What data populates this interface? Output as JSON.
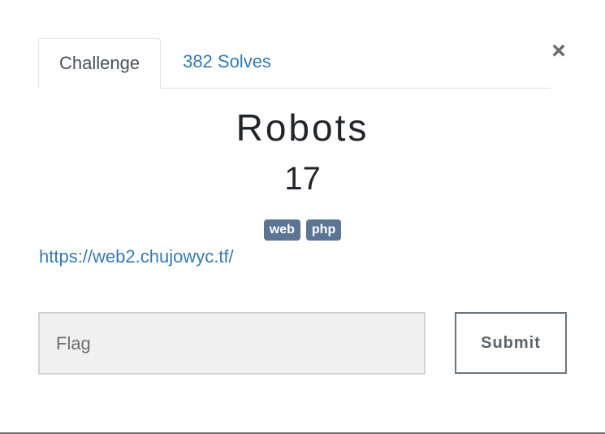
{
  "tabs": [
    {
      "label": "Challenge",
      "active": true
    },
    {
      "label": "382 Solves",
      "active": false
    }
  ],
  "close_glyph": "×",
  "challenge": {
    "name": "Robots",
    "points": "17",
    "tags": [
      "web",
      "php"
    ],
    "link": "https://web2.chujowyc.tf/"
  },
  "form": {
    "flag_placeholder": "Flag",
    "flag_value": "",
    "submit_label": "Submit"
  },
  "colors": {
    "link": "#337ab7",
    "tag_bg": "#5d7594",
    "input_bg": "#f0f0f0"
  }
}
